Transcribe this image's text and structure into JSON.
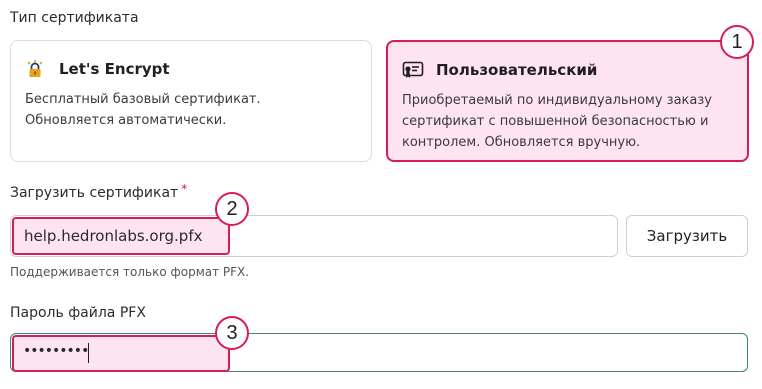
{
  "cert_type": {
    "label": "Тип сертификата",
    "options": [
      {
        "title": "Let's Encrypt",
        "icon": "lock-shield-icon",
        "description_line1": "Бесплатный базовый сертификат.",
        "description_line2": "Обновляется автоматически.",
        "selected": false
      },
      {
        "title": "Пользовательский",
        "icon": "certificate-icon",
        "description_line1": "Приобретаемый по индивидуальному заказу",
        "description_line2": "сертификат с повышенной безопасностью и",
        "description_line3": "контролем. Обновляется вручную.",
        "selected": true
      }
    ]
  },
  "upload": {
    "label": "Загрузить сертификат",
    "required_marker": "*",
    "file_value": "help.hedronlabs.org.pfx",
    "button_label": "Загрузить",
    "hint": "Поддерживается только формат PFX."
  },
  "password": {
    "label": "Пароль файла PFX",
    "value": "•••••••••"
  },
  "annotations": [
    "1",
    "2",
    "3"
  ],
  "colors": {
    "accent": "#d81b60",
    "accent_bg": "#fde4ee",
    "valid_border": "#3a8f5c"
  }
}
